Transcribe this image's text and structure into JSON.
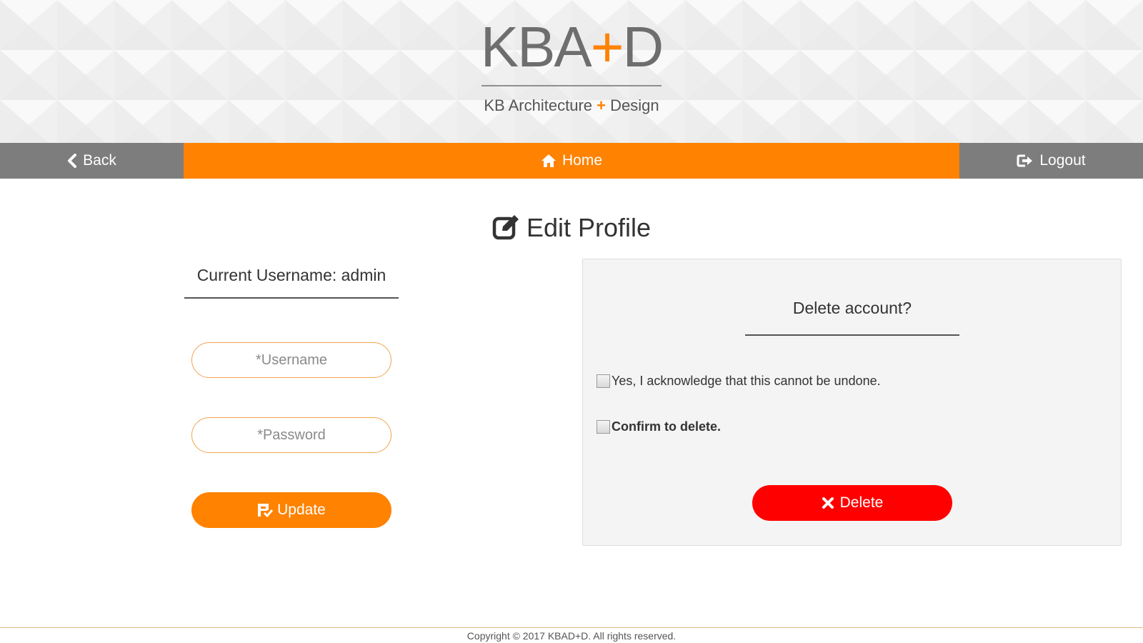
{
  "header": {
    "logo_left": "KBA",
    "logo_plus": "+",
    "logo_right": "D",
    "tagline_left": "KB Architecture",
    "tagline_plus": "+",
    "tagline_right": "Design"
  },
  "nav": {
    "back_label": "Back",
    "home_label": "Home",
    "logout_label": "Logout"
  },
  "page": {
    "title": "Edit Profile"
  },
  "profile_form": {
    "current_username": "Current Username: admin",
    "username_placeholder": "*Username",
    "password_placeholder": "*Password",
    "update_label": "Update"
  },
  "delete_panel": {
    "title": "Delete account?",
    "acknowledge_label": "Yes, I acknowledge that this cannot be undone.",
    "confirm_label": "Confirm to delete.",
    "delete_label": "Delete"
  },
  "footer": {
    "copyright": "Copyright © 2017 KBAD+D. All rights reserved."
  },
  "colors": {
    "accent": "#ff8200",
    "nav_gray": "#7d7d7d",
    "danger": "#ff0000",
    "panel_bg": "#f4f4f4"
  },
  "icons": {
    "back": "chevron-left-icon",
    "home": "home-icon",
    "logout": "logout-icon",
    "title": "edit-icon",
    "update": "update-icon",
    "delete": "x-icon"
  }
}
